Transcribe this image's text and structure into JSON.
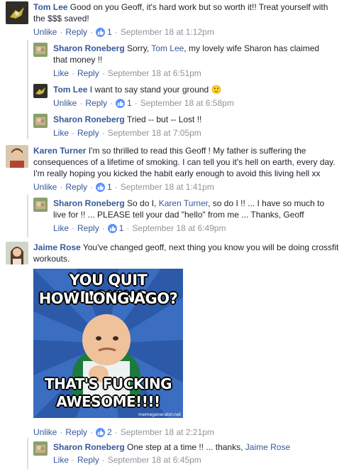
{
  "comments": [
    {
      "name": "Tom Lee",
      "text_pre": "Good on you Geoff, it's hard work but so worth it!! Treat yourself with the $$$ saved!",
      "actions": {
        "unlike": "Unlike",
        "reply": "Reply",
        "likes": "1",
        "time": "September 18 at 1:12pm"
      }
    },
    {
      "name": "Sharon Roneberg",
      "text_pre": "Sorry, ",
      "mention": "Tom Lee",
      "text_post": ", my lovely wife Sharon has claimed that money !!",
      "actions": {
        "like": "Like",
        "reply": "Reply",
        "time": "September 18 at 6:51pm"
      }
    },
    {
      "name": "Tom Lee",
      "text_pre": "I want to say stand your ground ",
      "emoji": "🙂",
      "actions": {
        "unlike": "Unlike",
        "reply": "Reply",
        "likes": "1",
        "time": "September 18 at 6:58pm"
      }
    },
    {
      "name": "Sharon Roneberg",
      "text_pre": "Tried -- but -- Lost !!",
      "actions": {
        "like": "Like",
        "reply": "Reply",
        "time": "September 18 at 7:05pm"
      }
    },
    {
      "name": "Karen Turner",
      "text_pre": "I'm so thrilled to read this Geoff ! My father is suffering the consequences of a lifetime of smoking. I can tell you it's hell on earth, every day. I'm really hoping you kicked the habit early enough to avoid this living hell xx",
      "actions": {
        "unlike": "Unlike",
        "reply": "Reply",
        "likes": "1",
        "time": "September 18 at 1:41pm"
      }
    },
    {
      "name": "Sharon Roneberg",
      "text_pre": "So do I, ",
      "mention": "Karen Turner",
      "text_post": ", so do I !! ... I have so much to live for !! ... PLEASE tell your dad \"hello\" from me ... Thanks, Geoff",
      "actions": {
        "like": "Like",
        "reply": "Reply",
        "likes": "1",
        "time": "September 18 at 6:49pm"
      }
    },
    {
      "name": "Jaime Rose",
      "text_pre": "You've changed geoff, next thing you know you will be doing crossfit workouts.",
      "actions": {
        "unlike": "Unlike",
        "reply": "Reply",
        "likes": "2",
        "time": "September 18 at 2:21pm"
      }
    },
    {
      "name": "Sharon Roneberg",
      "text_pre": "One step at a time !! ... thanks, ",
      "mention": "Jaime Rose",
      "actions": {
        "like": "Like",
        "reply": "Reply",
        "time": "September 18 at 6:45pm"
      }
    }
  ],
  "meme": {
    "top_line1": "YOU QUIT SMOKING",
    "top_line2": "HOW LONG AGO?",
    "bottom_line1": "THAT'S FUCKING",
    "bottom_line2": "AWESOME!!!!",
    "watermark": "memegenerator.net"
  },
  "separator": "·",
  "colors": {
    "link": "#365899",
    "meta": "#90949c",
    "like_badge": "#5890ff",
    "meme_bg": "#2c5aa8"
  }
}
